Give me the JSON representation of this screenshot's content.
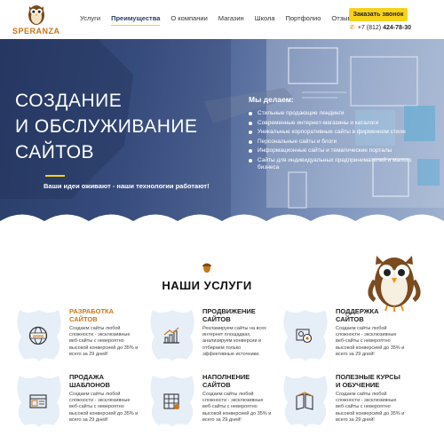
{
  "header": {
    "logo_text": "SPERANZA",
    "nav": [
      "Услуги",
      "Преимущества",
      "О компании",
      "Магазин",
      "Школа",
      "Портфолио",
      "Отзывы"
    ],
    "active_nav": "Преимущества",
    "call_button": "Заказать звонок",
    "phone_prefix": "+7 (812)",
    "phone_number": "424-78-30",
    "icons": [
      "owl-logo",
      "phone-icon"
    ]
  },
  "hero": {
    "title_lines": [
      "СОЗДАНИЕ",
      "И ОБСЛУЖИВАНИЕ",
      "САЙТОВ"
    ],
    "slogan": "Ваши идеи оживают - наши технологии работают!",
    "we_do_title": "Мы делаем:",
    "we_do": [
      "Стильные продающие лендинги",
      "Современные интернет-магазины и каталоги",
      "Уникальные корпоративные сайты в фирменном стиле",
      "Персональные сайты и блоги",
      "Информационные сайты и тематические порталы",
      "Сайты для индивидуальных предпринимателей и малого бизнеса"
    ],
    "colors": {
      "overlay": "#2b3f6b",
      "accent": "#f5d21a"
    }
  },
  "services": {
    "title": "НАШИ УСЛУГИ",
    "items": [
      {
        "title": "РАЗРАБОТКА САЙТОВ",
        "highlight": true,
        "icon": "www-icon",
        "description": "Создаем сайты любой сложности - эксклюзивные веб-сайты с невероятно высокой конверсией до 35% и всего за 29 дней!"
      },
      {
        "title": "ПРОДВИЖЕНИЕ САЙТОВ",
        "highlight": false,
        "icon": "growth-chart-icon",
        "description": "Рекламируем сайты на всех интернет площадках, анализируем конверсии и отбираем только эффективные источники."
      },
      {
        "title": "ПОДДЕРЖКА САЙТОВ",
        "highlight": false,
        "icon": "gears-icon",
        "description": "Создаем сайты любой сложности - эксклюзивные веб-сайты с невероятно высокой конверсией до 35% и всего за 29 дней!"
      },
      {
        "title": "ПРОДАЖА ШАБЛОНОВ",
        "highlight": false,
        "icon": "template-icon",
        "description": "Создаем сайты любой сложности - эксклюзивные веб-сайты с невероятно высокой конверсией до 35% и всего за 29 дней!"
      },
      {
        "title": "НАПОЛНЕНИЕ САЙТОВ",
        "highlight": false,
        "icon": "content-grid-icon",
        "description": "Создаем сайты любой сложности - эксклюзивные веб-сайты с невероятно высокой конверсией до 35% и всего за 29 дней!"
      },
      {
        "title": "ПОЛЕЗНЫЕ КУРСЫ И ОБУЧЕНИЕ",
        "highlight": false,
        "icon": "book-icon",
        "description": "Создаем сайты любой сложности - эксклюзивные веб-сайты с невероятно высокой конверсией до 35% и всего за 29 дней!"
      }
    ],
    "colors": {
      "accent_title": "#c77718",
      "blob": "#e6eef8"
    }
  }
}
